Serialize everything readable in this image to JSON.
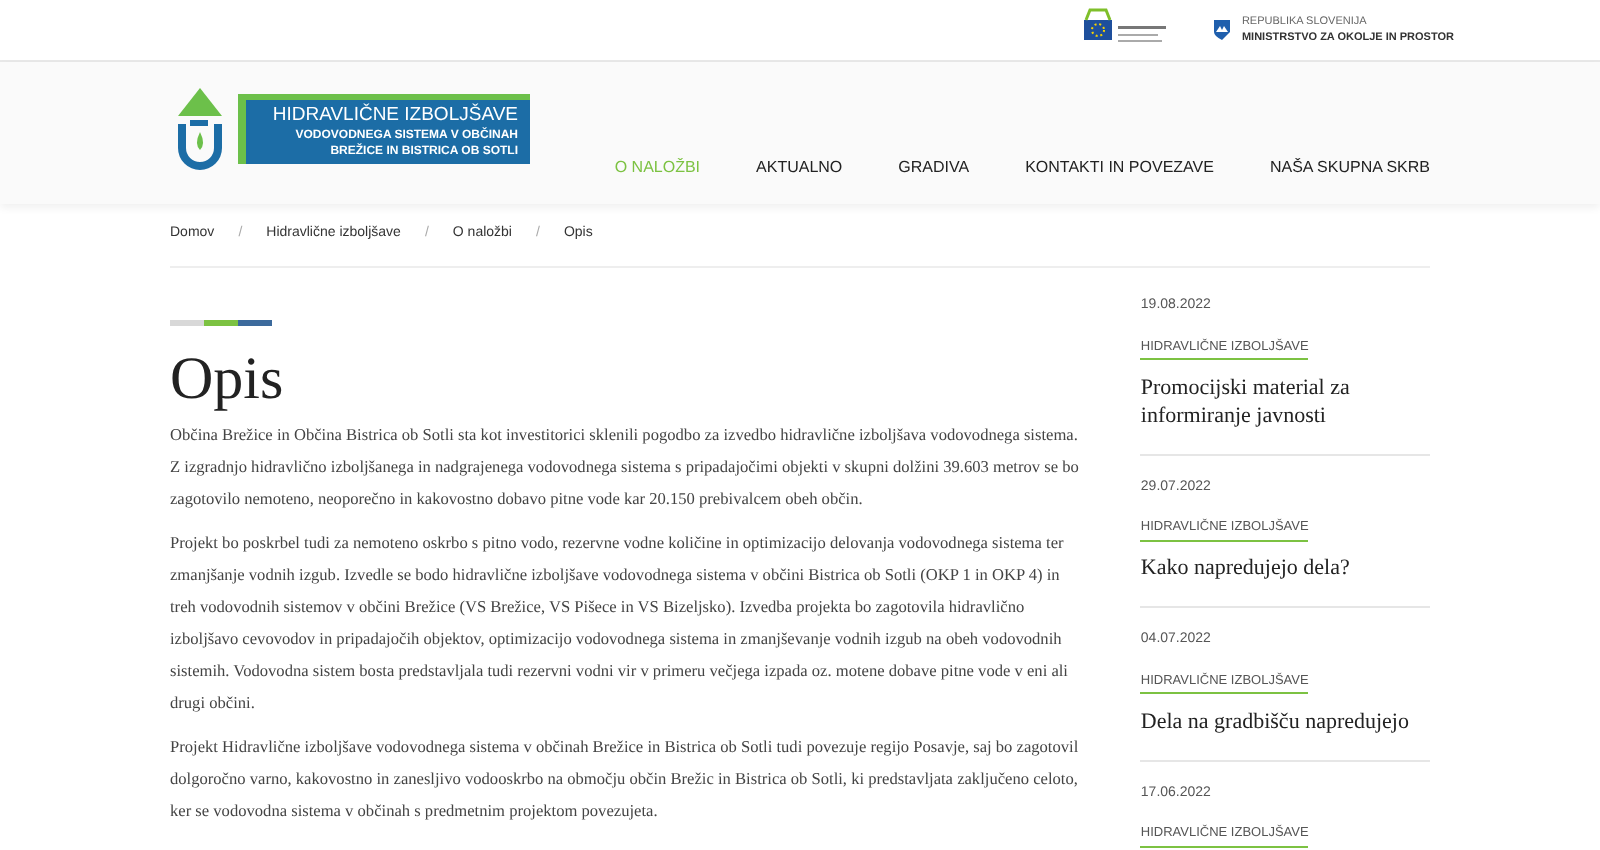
{
  "top_bar": {
    "ministry": {
      "line_1": "REPUBLIKA SLOVENIJA",
      "line_2": "MINISTRSTVO ZA OKOLJE IN PROSTOR"
    }
  },
  "logo": {
    "title": "HIDRAVLIČNE IZBOLJŠAVE",
    "subtitle_1": "VODOVODNEGA SISTEMA V OBČINAH",
    "subtitle_2": "BREŽICE IN BISTRICA OB SOTLI"
  },
  "nav": [
    {
      "label": "O NALOŽBI",
      "selected": true
    },
    {
      "label": "AKTUALNO",
      "selected": false
    },
    {
      "label": "GRADIVA",
      "selected": false
    },
    {
      "label": "KONTAKTI IN POVEZAVE",
      "selected": false
    },
    {
      "label": "NAŠA SKUPNA SKRB",
      "selected": false
    }
  ],
  "breadcrumb": [
    "Domov",
    "Hidravlične izboljšave",
    "O naložbi",
    "Opis"
  ],
  "breadcrumb_separator": "/",
  "page_title": "Opis",
  "paragraphs": [
    "Občina Brežice in Občina Bistrica ob Sotli sta kot investitorici sklenili pogodbo za izvedbo hidravlične izboljšava vodovodnega sistema. Z izgradnjo hidravlično izboljšanega in nadgrajenega vodovodnega sistema s pripadajočimi objekti v skupni dolžini 39.603 metrov se bo zagotovilo nemoteno, neoporečno in kakovostno dobavo pitne vode kar 20.150 prebivalcem obeh občin.",
    "Projekt bo poskrbel tudi za nemoteno oskrbo s pitno vodo, rezervne vodne količine in optimizacijo delovanja vodovodnega sistema ter zmanjšanje vodnih izgub. Izvedle se bodo hidravlične izboljšave vodovodnega sistema v občini Bistrica ob Sotli (OKP 1 in OKP 4) in treh vodovodnih sistemov v občini Brežice (VS Brežice, VS Pišece in VS Bizeljsko). Izvedba projekta bo zagotovila hidravlično izboljšavo cevovodov in pripadajočih objektov, optimizacijo vodovodnega sistema in zmanjševanje vodnih izgub na obeh vodovodnih sistemih. Vodovodna sistem bosta predstavljala tudi rezervni vodni vir v primeru večjega izpada oz. motene dobave pitne vode v eni ali drugi občini.",
    "Projekt Hidravlične izboljšave vodovodnega sistema v občinah Brežice in Bistrica ob Sotli tudi povezuje regijo Posavje, saj bo zagotovil dolgoročno varno, kakovostno in zanesljivo vodooskrbo na območju občin Brežic in Bistrica ob Sotli, ki predstavljata zaključeno celoto, ker se vodovodna sistema v občinah s predmetnim projektom povezujeta."
  ],
  "news": [
    {
      "date": "19.08.2022",
      "category": "HIDRAVLIČNE IZBOLJŠAVE",
      "title": "Promocijski material za informiranje javnosti"
    },
    {
      "date": "29.07.2022",
      "category": "HIDRAVLIČNE IZBOLJŠAVE",
      "title": "Kako napredujejo dela?"
    },
    {
      "date": "04.07.2022",
      "category": "HIDRAVLIČNE IZBOLJŠAVE",
      "title": "Dela na gradbišču napredujejo"
    },
    {
      "date": "17.06.2022",
      "category": "HIDRAVLIČNE IZBOLJŠAVE"
    }
  ]
}
